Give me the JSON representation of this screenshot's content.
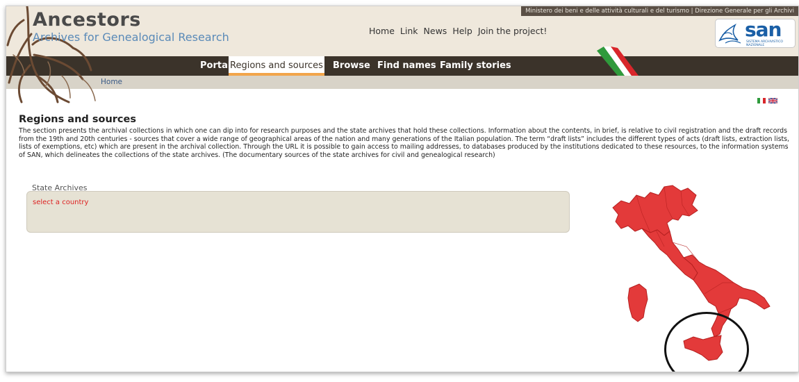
{
  "header": {
    "title": "Ancestors",
    "subtitle": "Archives for Genealogical Research",
    "top_links": [
      "Home",
      "Link",
      "News",
      "Help",
      "Join the project!"
    ],
    "ministry_text": "Ministero dei beni e delle attività culturali e del turismo  |  Direzione Generale per gli Archivi",
    "san_logo_text": "SAN",
    "san_logo_subtext": "SISTEMA ARCHIVISTICO NAZIONALE"
  },
  "main_nav": {
    "tabs": [
      "Portal",
      "Regions and sources",
      "Browse",
      "Find names",
      "Family stories"
    ],
    "active_tab": "Regions and sources"
  },
  "breadcrumb": {
    "home": "Home"
  },
  "language_flags": [
    "italian-flag",
    "uk-flag"
  ],
  "content": {
    "title": "Regions and sources",
    "description": "The section presents the archival collections in which one can dip into for research purposes and the state archives that hold these collections. Information about the contents, in brief, is relative to civil registration and the draft records from the 19th and 20th centuries - sources that cover a wide range of geographical areas of the nation and many generations of the Italian population. The term “draft lists” includes the different types of acts (draft lists, extraction lists, lists of exemptions, etc) which are present in the archival collection. Through the URL it is possible to gain access to mailing addresses, to databases produced by the institutions dedicated to these resources, to the information systems of SAN, which delineates the collections of the state archives. (The documentary sources of the state archives for civil and genealogical research)"
  },
  "state_archives": {
    "label": "State Archives",
    "placeholder": "select a country"
  },
  "map": {
    "country": "Italy",
    "fill_color": "#e33a3a",
    "highlighted_region": "Sicily"
  },
  "colors": {
    "nav_bg": "#3b332a",
    "active_underline": "#f2a54a",
    "link_blue": "#5a8ab8",
    "placeholder_red": "#dd2222"
  }
}
